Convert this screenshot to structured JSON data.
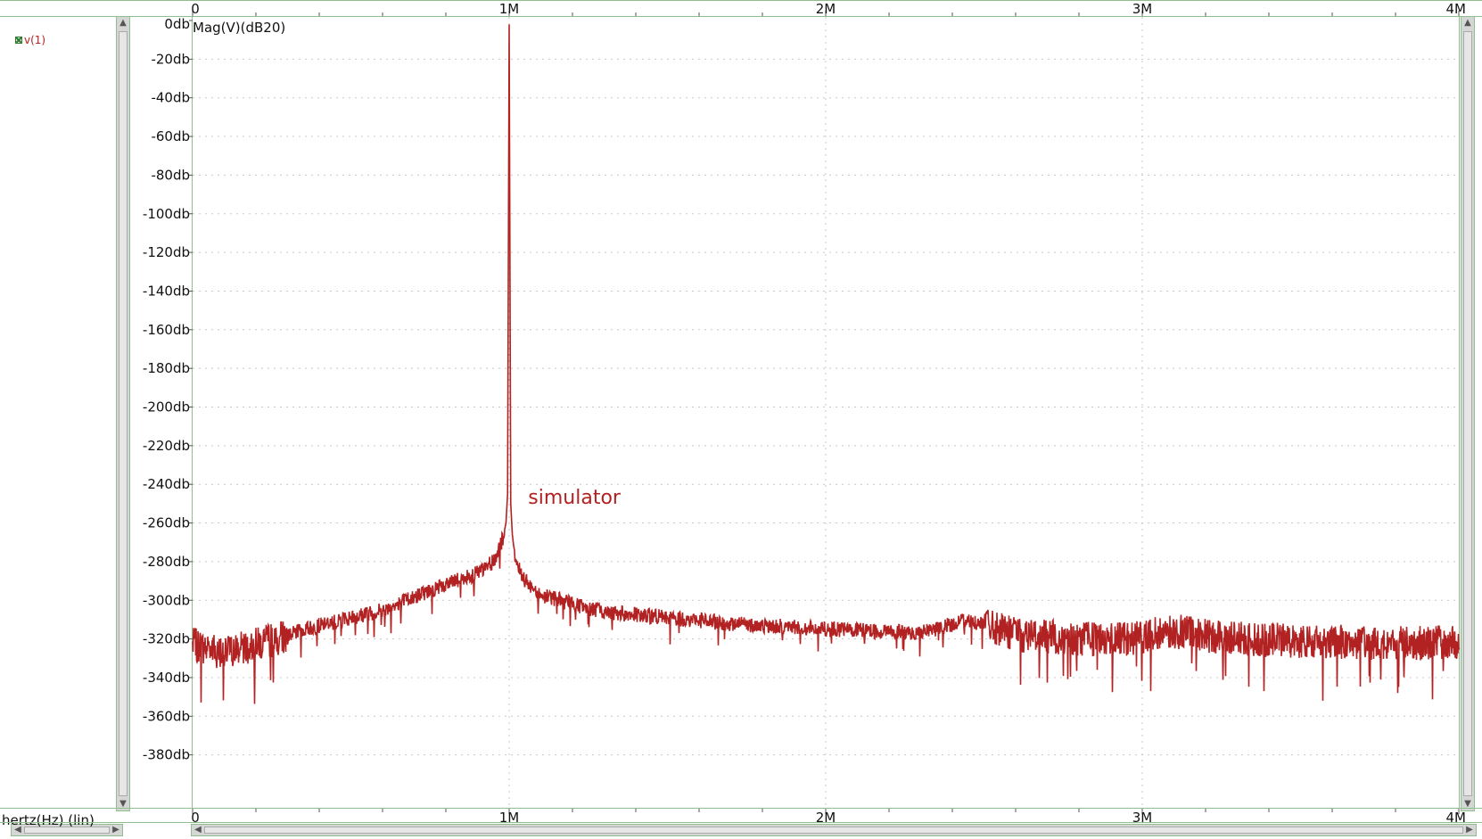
{
  "legend": {
    "trace_label": "v(1)",
    "trace_icon": "trace-toggle-icon"
  },
  "xunit_label": "hertz(Hz) (lin)",
  "chart_data": {
    "type": "line",
    "ylabel": "Mag(V)(dB20)",
    "xlim": [
      0,
      4000000
    ],
    "ylim": [
      -400,
      0
    ],
    "x_ticks": [
      0,
      1000000,
      2000000,
      3000000,
      4000000
    ],
    "x_tick_labels": [
      "0",
      "1M",
      "2M",
      "3M",
      "4M"
    ],
    "y_ticks": [
      0,
      -20,
      -40,
      -60,
      -80,
      -100,
      -120,
      -140,
      -160,
      -180,
      -200,
      -220,
      -240,
      -260,
      -280,
      -300,
      -320,
      -340,
      -360,
      -380
    ],
    "y_tick_labels": [
      "0db",
      "-20db",
      "-40db",
      "-60db",
      "-80db",
      "-100db",
      "-120db",
      "-140db",
      "-160db",
      "-180db",
      "-200db",
      "-220db",
      "-240db",
      "-260db",
      "-280db",
      "-300db",
      "-320db",
      "-340db",
      "-360db",
      "-380db"
    ],
    "grid": true,
    "series": [
      {
        "name": "v(1)",
        "color": "#b22222",
        "x": [
          0,
          100000,
          200000,
          300000,
          400000,
          500000,
          600000,
          700000,
          800000,
          900000,
          950000,
          980000,
          990000,
          995000,
          1000000,
          1005000,
          1010000,
          1020000,
          1050000,
          1100000,
          1200000,
          1300000,
          1500000,
          1700000,
          2000000,
          2300000,
          2450000,
          2600000,
          2800000,
          2950000,
          3050000,
          3100000,
          3300000,
          3500000,
          3700000,
          3900000,
          4000000
        ],
        "y": [
          -323,
          -327,
          -323,
          -318,
          -313,
          -309,
          -305,
          -298,
          -292,
          -286,
          -280,
          -268,
          -260,
          -245,
          -2,
          -250,
          -266,
          -280,
          -290,
          -297,
          -302,
          -306,
          -309,
          -312,
          -315,
          -317,
          -310,
          -318,
          -320,
          -320,
          -317,
          -316,
          -320,
          -321,
          -322,
          -322,
          -322
        ]
      }
    ],
    "annotations": [
      {
        "text": "simulator",
        "x": 1060000,
        "y": -250
      }
    ]
  },
  "colors": {
    "trace": "#b22222",
    "frame": "#8fbf8f",
    "grid": "#c8c8c8"
  }
}
